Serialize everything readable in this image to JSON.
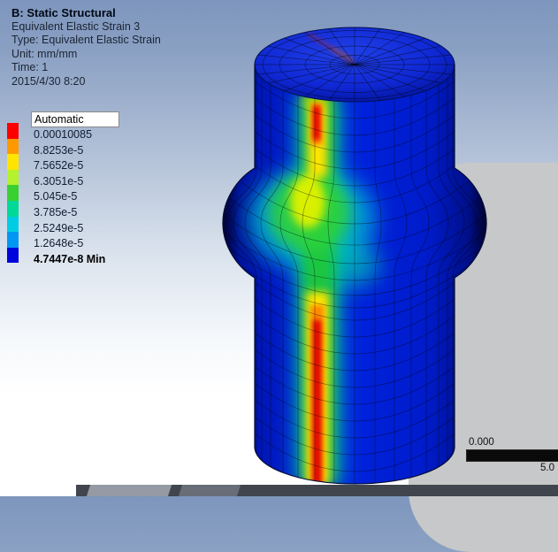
{
  "header": {
    "title": "B: Static Structural",
    "result_name": "Equivalent Elastic Strain 3",
    "type_line": "Type: Equivalent Elastic Strain",
    "unit_line": "Unit: mm/mm",
    "time_line": "Time: 1",
    "date_line": "2015/4/30 8:20"
  },
  "legend": {
    "caption": "Automatic",
    "entries": [
      {
        "label": "0.00010085",
        "color": "#fe0000"
      },
      {
        "label": "8.8253e-5",
        "color": "#ff9900"
      },
      {
        "label": "7.5652e-5",
        "color": "#ffe400"
      },
      {
        "label": "6.3051e-5",
        "color": "#b5f12c"
      },
      {
        "label": "5.045e-5",
        "color": "#38d131"
      },
      {
        "label": "3.785e-5",
        "color": "#00d898"
      },
      {
        "label": "2.5249e-5",
        "color": "#00cde4"
      },
      {
        "label": "1.2648e-5",
        "color": "#0096f2"
      },
      {
        "label": "4.7447e-8 Min",
        "color": "#0005dc"
      }
    ]
  },
  "ruler": {
    "start_label": "0.000",
    "end_label": "5.0"
  },
  "colors": {
    "model_blue": "#0018d0",
    "background_top": "#7e96bd",
    "shadow_gray": "#c7c8c9"
  }
}
